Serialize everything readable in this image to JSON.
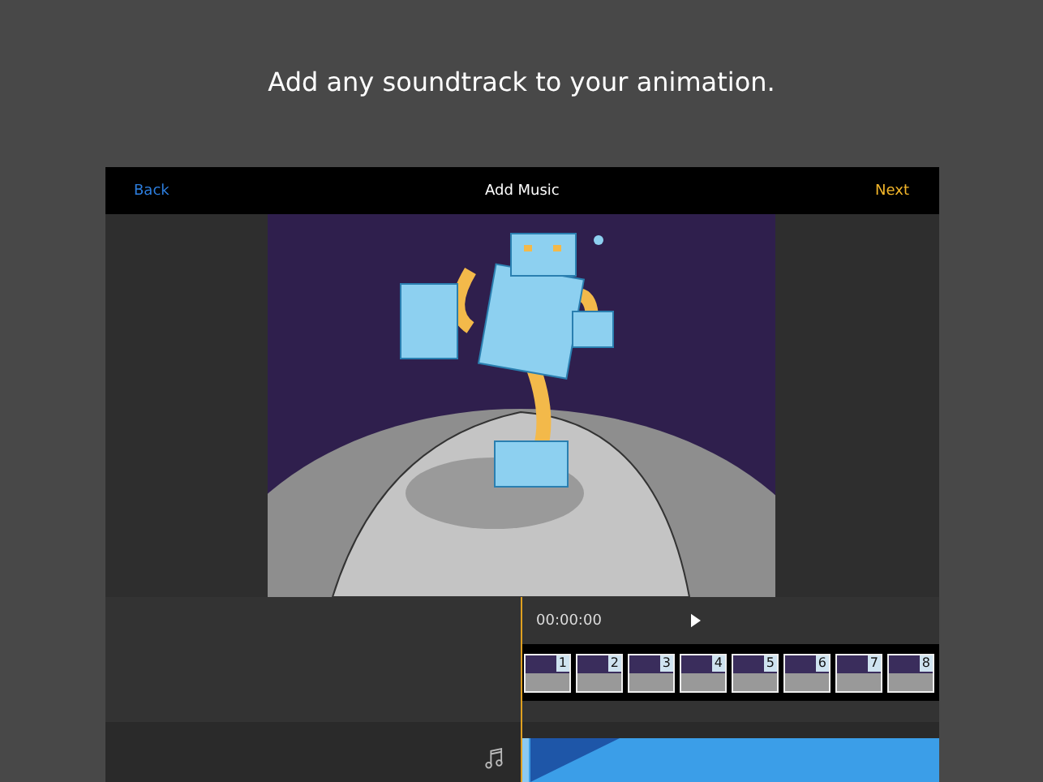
{
  "headline": "Add any soundtrack to your animation.",
  "nav": {
    "back": "Back",
    "title": "Add Music",
    "next": "Next"
  },
  "timeline": {
    "time": "00:00:00",
    "frames": [
      {
        "label": "1"
      },
      {
        "label": "2"
      },
      {
        "label": "3"
      },
      {
        "label": "4"
      },
      {
        "label": "5"
      },
      {
        "label": "6"
      },
      {
        "label": "7"
      },
      {
        "label": "8"
      }
    ]
  }
}
